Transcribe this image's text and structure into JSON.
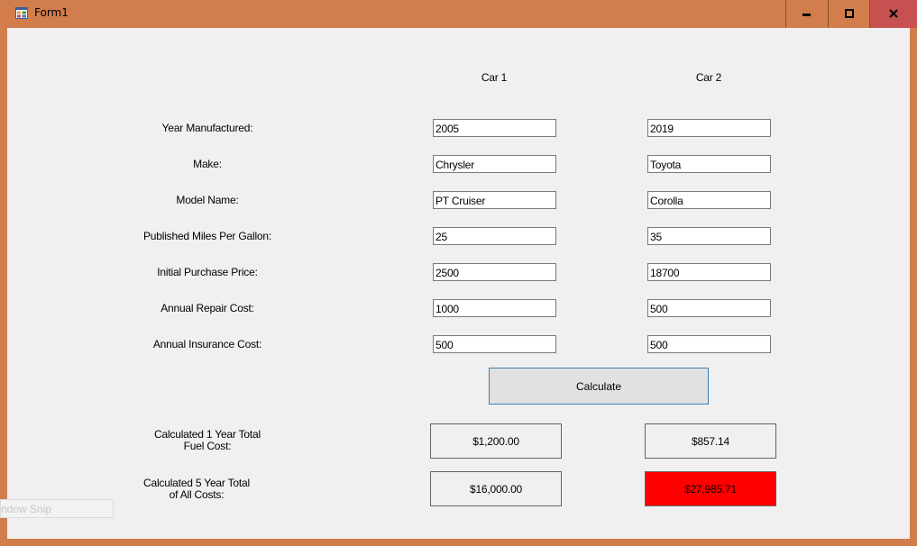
{
  "window": {
    "title": "Form1",
    "icon": "form-app-icon",
    "controls": {
      "minimize_icon": "minimize-icon",
      "maximize_icon": "maximize-icon",
      "close_icon": "close-icon"
    },
    "colors": {
      "title_bar": "#d27d4c",
      "close_button": "#c75050",
      "client_background": "#f0f0f0",
      "highlight_red": "#ff0000"
    }
  },
  "columns": {
    "car1": "Car 1",
    "car2": "Car 2"
  },
  "rows": [
    {
      "label": "Year Manufactured:",
      "car1": "2005",
      "car2": "2019"
    },
    {
      "label": "Make:",
      "car1": "Chrysler",
      "car2": "Toyota"
    },
    {
      "label": "Model Name:",
      "car1": "PT Cruiser",
      "car2": "Corolla"
    },
    {
      "label": "Published Miles Per Gallon:",
      "car1": "25",
      "car2": "35"
    },
    {
      "label": "Initial Purchase Price:",
      "car1": "2500",
      "car2": "18700"
    },
    {
      "label": "Annual Repair Cost:",
      "car1": "1000",
      "car2": "500"
    },
    {
      "label": "Annual Insurance Cost:",
      "car1": "500",
      "car2": "500"
    }
  ],
  "calculate_button": "Calculate",
  "results": {
    "fuel_cost": {
      "label_line1": "Calculated 1 Year Total",
      "label_line2": "Fuel Cost:",
      "car1": "$1,200.00",
      "car2": "$857.14"
    },
    "total_cost": {
      "label_line1": "Calculated 5 Year Total",
      "label_line2": "of All Costs:",
      "car1": "$16,000.00",
      "car2": "$27,985.71"
    }
  },
  "overlay": {
    "snip_text": "ndow Snip"
  }
}
